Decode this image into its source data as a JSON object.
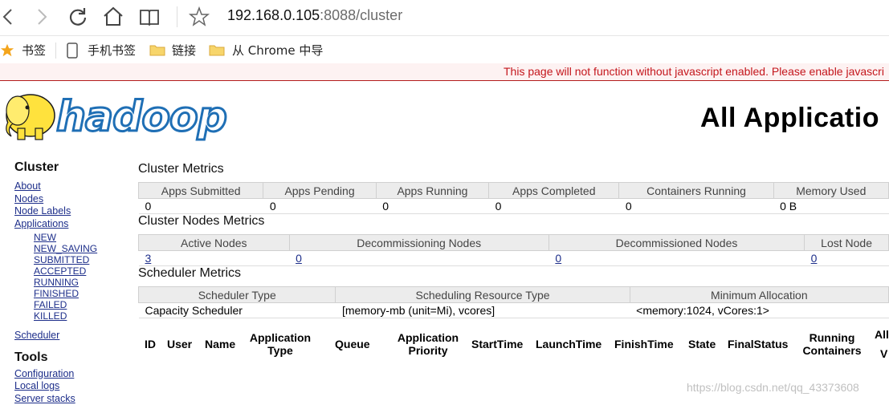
{
  "browser": {
    "url_host": "192.168.0.105",
    "url_rest": ":8088/cluster",
    "bookmarks": [
      "书签",
      "手机书签",
      "链接",
      "从 Chrome 中导"
    ]
  },
  "noscript_warning": "This page will not function without javascript enabled. Please enable javascri",
  "logo_text": "hadoop",
  "page_title": "All Applicatio",
  "nav": {
    "cluster_heading": "Cluster",
    "about": "About",
    "nodes": "Nodes",
    "node_labels": "Node Labels",
    "applications": "Applications",
    "states": [
      "NEW",
      "NEW_SAVING",
      "SUBMITTED",
      "ACCEPTED",
      "RUNNING",
      "FINISHED",
      "FAILED",
      "KILLED"
    ],
    "scheduler": "Scheduler",
    "tools_heading": "Tools",
    "configuration": "Configuration",
    "local_logs": "Local logs",
    "server_stacks": "Server stacks"
  },
  "cluster_metrics": {
    "title": "Cluster Metrics",
    "headers": [
      "Apps Submitted",
      "Apps Pending",
      "Apps Running",
      "Apps Completed",
      "Containers Running",
      "Memory Used"
    ],
    "values": [
      "0",
      "0",
      "0",
      "0",
      "0",
      "0 B"
    ]
  },
  "nodes_metrics": {
    "title": "Cluster Nodes Metrics",
    "headers": [
      "Active Nodes",
      "Decommissioning Nodes",
      "Decommissioned Nodes",
      "Lost Node"
    ],
    "values": [
      "3",
      "0",
      "0",
      "0"
    ]
  },
  "scheduler_metrics": {
    "title": "Scheduler Metrics",
    "headers": [
      "Scheduler Type",
      "Scheduling Resource Type",
      "Minimum Allocation"
    ],
    "values": [
      "Capacity Scheduler",
      "[memory-mb (unit=Mi), vcores]",
      "<memory:1024, vCores:1>"
    ]
  },
  "apps_table": {
    "headers": {
      "id": "ID",
      "user": "User",
      "name": "Name",
      "app_type_1": "Application",
      "app_type_2": "Type",
      "queue": "Queue",
      "priority_1": "Application",
      "priority_2": "Priority",
      "start": "StartTime",
      "launch": "LaunchTime",
      "finish": "FinishTime",
      "state": "State",
      "final": "FinalStatus",
      "running_1": "Running",
      "running_2": "Containers",
      "alloc_1": "All",
      "alloc_2": "V"
    }
  },
  "watermark": "https://blog.csdn.net/qq_43373608"
}
